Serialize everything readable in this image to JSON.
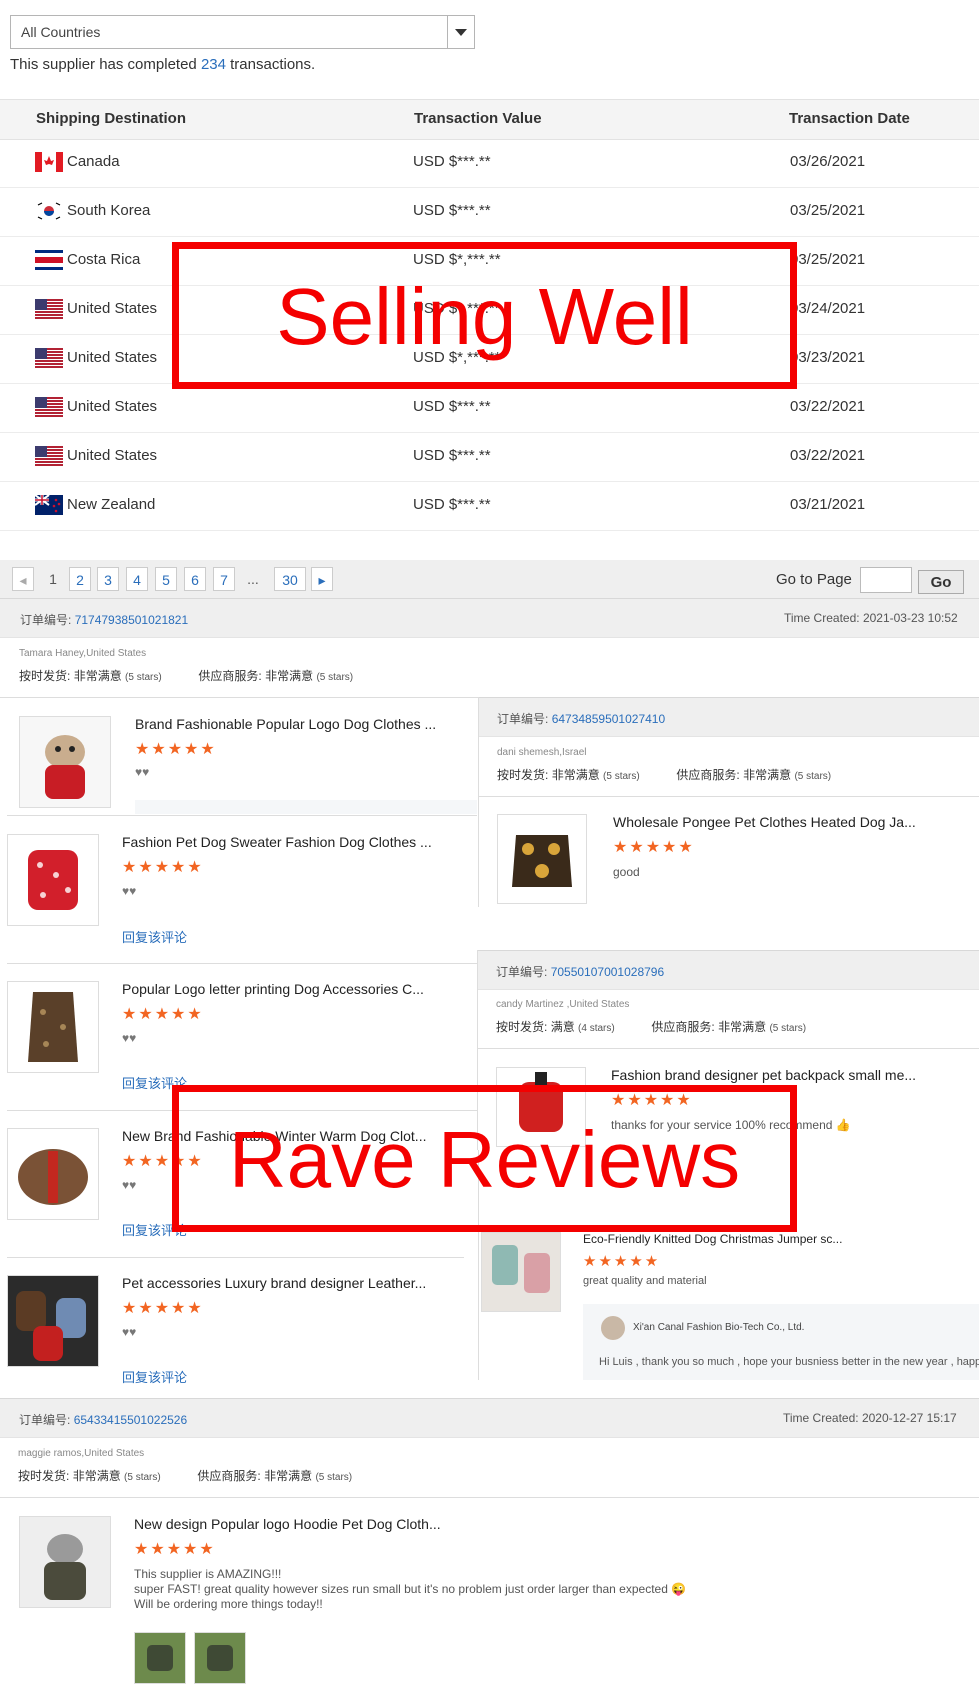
{
  "filter": {
    "country": "All Countries"
  },
  "summary": {
    "prefix": "This supplier has completed ",
    "count": "234",
    "suffix": " transactions."
  },
  "table": {
    "headers": [
      "Shipping Destination",
      "Transaction Value",
      "Transaction Date"
    ],
    "rows": [
      {
        "country": "Canada",
        "flag": "canada-flag-icon",
        "value": "USD $***.**",
        "date": "03/26/2021"
      },
      {
        "country": "South Korea",
        "flag": "south-korea-flag-icon",
        "value": "USD $***.**",
        "date": "03/25/2021"
      },
      {
        "country": "Costa Rica",
        "flag": "costa-rica-flag-icon",
        "value": "USD $*,***.**",
        "date": "03/25/2021"
      },
      {
        "country": "United States",
        "flag": "us-flag-icon",
        "value": "USD $*,***.**",
        "date": "03/24/2021"
      },
      {
        "country": "United States",
        "flag": "us-flag-icon",
        "value": "USD $*,***.**",
        "date": "03/23/2021"
      },
      {
        "country": "United States",
        "flag": "us-flag-icon",
        "value": "USD $***.**",
        "date": "03/22/2021"
      },
      {
        "country": "United States",
        "flag": "us-flag-icon",
        "value": "USD $***.**",
        "date": "03/22/2021"
      },
      {
        "country": "New Zealand",
        "flag": "new-zealand-flag-icon",
        "value": "USD $***.**",
        "date": "03/21/2021"
      }
    ]
  },
  "pagination": {
    "pages": [
      "1",
      "2",
      "3",
      "4",
      "5",
      "6",
      "7",
      "...",
      "30"
    ],
    "goto_label": "Go to Page",
    "go_button": "Go"
  },
  "overlays": {
    "selling": "Selling Well",
    "reviews": "Rave Reviews"
  },
  "colors": {
    "accent_link": "#2a6ebb",
    "star": "#f26522",
    "overlay_red": "#f40000"
  },
  "reviews": {
    "order_label": "订单编号:",
    "time_label": "Time Created:",
    "ontime_label": "按时发货:",
    "service_label": "供应商服务:",
    "reply_label": "回复该评论",
    "stars": "★★★★★",
    "hearts": "♥♥",
    "order1": {
      "id": "71747938501021821",
      "time": "2021-03-23 10:52",
      "reviewer": "Tamara Haney,United States",
      "ontime": "非常满意",
      "ontime_stars": "(5 stars)",
      "service": "非常满意",
      "service_stars": "(5 stars)"
    },
    "left_products": [
      {
        "title": "Brand Fashionable Popular Logo Dog Clothes ..."
      },
      {
        "title": "Fashion Pet Dog Sweater Fashion Dog Clothes ..."
      },
      {
        "title": "Popular Logo letter printing Dog Accessories C..."
      },
      {
        "title": "New Brand Fashionable Winter Warm Dog Clot..."
      },
      {
        "title": "Pet accessories Luxury brand designer Leather..."
      }
    ],
    "order2": {
      "id": "64734859501027410",
      "reviewer": "dani shemesh,Israel",
      "ontime": "非常满意",
      "ontime_stars": "(5 stars)",
      "service": "非常满意",
      "service_stars": "(5 stars)",
      "product": "Wholesale Pongee Pet Clothes Heated Dog Ja...",
      "comment": "good"
    },
    "order3": {
      "id": "70550107001028796",
      "reviewer": "candy Martinez ,United States",
      "ontime": "满意",
      "ontime_stars": "(4 stars)",
      "service": "非常满意",
      "service_stars": "(5 stars)",
      "product": "Fashion brand designer pet backpack small me...",
      "comment": "thanks for your service 100% recommend 👍"
    },
    "order4": {
      "product": "Eco-Friendly Knitted Dog Christmas Jumper sc...",
      "comment": "great quality and material",
      "seller_name": "Xi'an Canal Fashion Bio-Tech Co., Ltd.",
      "seller_reply": "Hi Luis , thank you so much , hope your  busniess better in the new year , happy"
    },
    "order5": {
      "id": "65433415501022526",
      "time": "2020-12-27 15:17",
      "reviewer": "maggie ramos,United States",
      "ontime": "非常满意",
      "ontime_stars": "(5 stars)",
      "service": "非常满意",
      "service_stars": "(5 stars)",
      "product": "New design Popular logo Hoodie Pet Dog Cloth...",
      "comment_lines": [
        "This supplier is AMAZING!!!",
        "super FAST! great quality however sizes run small but it's no problem just order larger than expected 😜",
        "Will be ordering more things today!!"
      ]
    }
  }
}
